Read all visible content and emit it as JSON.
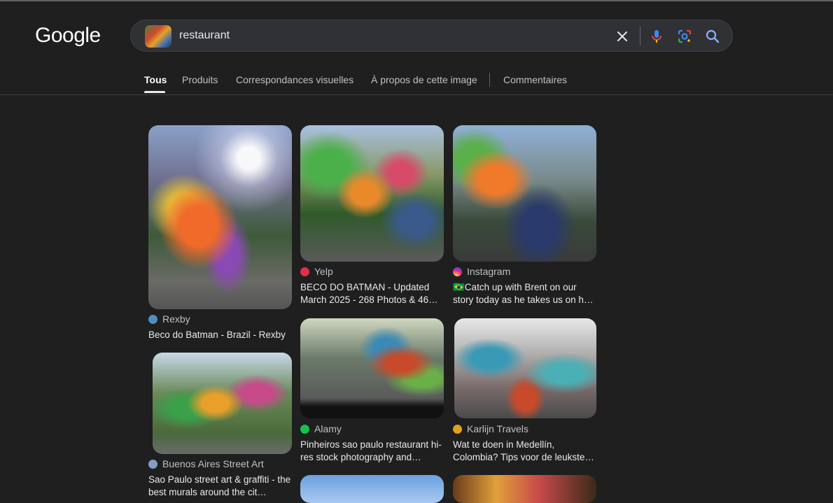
{
  "header": {
    "logo": "Google",
    "query": "restaurant"
  },
  "tabs": [
    {
      "label": "Tous",
      "active": true
    },
    {
      "label": "Produits"
    },
    {
      "label": "Correspondances visuelles"
    },
    {
      "label": "À propos de cette image"
    },
    {
      "label": "Commentaires"
    }
  ],
  "results": [
    {
      "source": "Rexby",
      "title": "Beco do Batman - Brazil - Rexby",
      "favicon_color": "#4f8fc0"
    },
    {
      "source": "Yelp",
      "title": "BECO DO BATMAN - Updated March 2025 - 268 Photos & 46…",
      "favicon_color": "#e0304a"
    },
    {
      "source": "Instagram",
      "title": "🇧🇷Catch up with Brent on our story today as he takes us on h…",
      "favicon_color": "#d62976"
    },
    {
      "source": "Buenos Aires Street Art",
      "title": "Sao Paulo street art & graffiti - the best murals around the cit…",
      "favicon_color": "#7fa0c0"
    },
    {
      "source": "Alamy",
      "title": "Pinheiros sao paulo restaurant hi-res stock photography and…",
      "favicon_color": "#12c24a"
    },
    {
      "source": "Karlijn Travels",
      "title": "Wat te doen in Medellín, Colombia? Tips voor de leukste…",
      "favicon_color": "#e0a020"
    }
  ]
}
